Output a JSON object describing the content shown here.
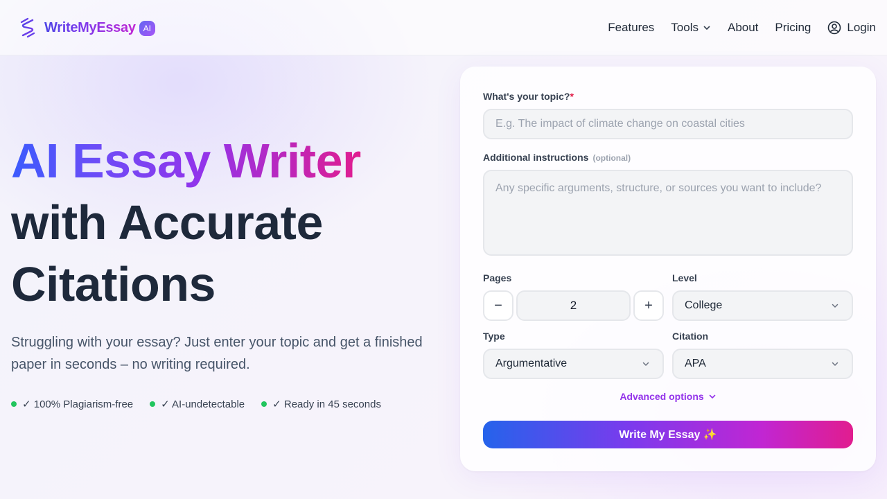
{
  "brand": {
    "name": "WriteMyEssay",
    "badge": "AI",
    "accent": "#7c3aed",
    "accent2": "#e11d8f"
  },
  "nav": {
    "items": [
      "Features",
      "Tools",
      "About",
      "Pricing"
    ],
    "login": "Login"
  },
  "hero": {
    "title_gradient": "AI Essay Writer",
    "title_line2": "with Accurate",
    "title_line3": "Citations",
    "subtitle": "Struggling with your essay? Just enter your topic and get a finished paper in seconds – no writing required.",
    "badges": [
      "✓ 100% Plagiarism-free",
      "✓ AI-undetectable",
      "✓ Ready in 45 seconds"
    ]
  },
  "form": {
    "topic": {
      "label": "What's your topic?",
      "required_mark": "*",
      "placeholder": "E.g. The impact of climate change on coastal cities",
      "value": ""
    },
    "instructions": {
      "label": "Additional instructions",
      "optional": "(optional)",
      "placeholder": "Any specific arguments, structure, or sources you want to include?",
      "value": ""
    },
    "pages": {
      "label": "Pages",
      "value": "2",
      "minus": "−",
      "plus": "+"
    },
    "level": {
      "label": "Level",
      "value": "College"
    },
    "type": {
      "label": "Type",
      "value": "Argumentative"
    },
    "citation": {
      "label": "Citation",
      "value": "APA"
    },
    "advanced": "Advanced options",
    "submit": "Write My Essay ✨"
  }
}
